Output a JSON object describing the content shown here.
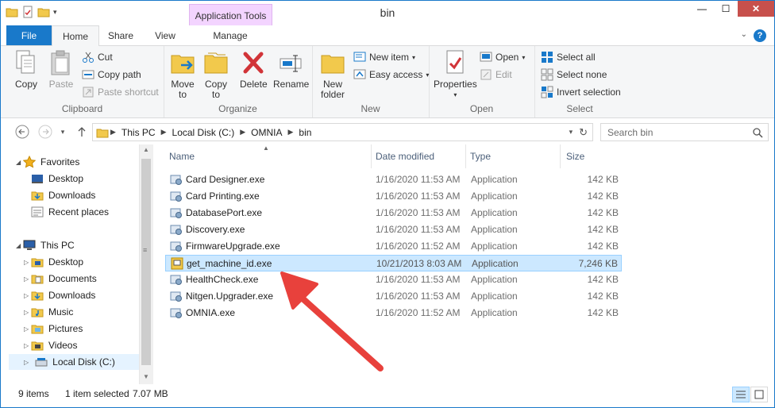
{
  "window": {
    "title": "bin",
    "contextual_tab": "Application Tools",
    "controls": {
      "minimize": "—",
      "maximize": "☐",
      "close": "✕"
    }
  },
  "tabs": {
    "file": "File",
    "home": "Home",
    "share": "Share",
    "view": "View",
    "manage": "Manage"
  },
  "ribbon": {
    "clipboard": {
      "label": "Clipboard",
      "copy": "Copy",
      "paste": "Paste",
      "cut": "Cut",
      "copy_path": "Copy path",
      "paste_shortcut": "Paste shortcut"
    },
    "organize": {
      "label": "Organize",
      "move_to_1": "Move",
      "move_to_2": "to",
      "copy_to_1": "Copy",
      "copy_to_2": "to",
      "delete": "Delete",
      "rename": "Rename"
    },
    "new": {
      "label": "New",
      "new_folder_1": "New",
      "new_folder_2": "folder",
      "new_item": "New item",
      "easy_access": "Easy access"
    },
    "open": {
      "label": "Open",
      "properties": "Properties",
      "open": "Open",
      "edit": "Edit"
    },
    "select": {
      "label": "Select",
      "select_all": "Select all",
      "select_none": "Select none",
      "invert_selection": "Invert selection"
    }
  },
  "address": {
    "crumbs": [
      "This PC",
      "Local Disk (C:)",
      "OMNIA",
      "bin"
    ],
    "search_placeholder": "Search bin"
  },
  "nav": {
    "favorites": "Favorites",
    "desktop": "Desktop",
    "downloads": "Downloads",
    "recent": "Recent places",
    "this_pc": "This PC",
    "pc_desktop": "Desktop",
    "documents": "Documents",
    "pc_downloads": "Downloads",
    "music": "Music",
    "pictures": "Pictures",
    "videos": "Videos",
    "local_disk": "Local Disk (C:)"
  },
  "columns": {
    "name": "Name",
    "date": "Date modified",
    "type": "Type",
    "size": "Size"
  },
  "files": [
    {
      "name": "Card Designer.exe",
      "date": "1/16/2020 11:53 AM",
      "type": "Application",
      "size": "142 KB"
    },
    {
      "name": "Card Printing.exe",
      "date": "1/16/2020 11:53 AM",
      "type": "Application",
      "size": "142 KB"
    },
    {
      "name": "DatabasePort.exe",
      "date": "1/16/2020 11:53 AM",
      "type": "Application",
      "size": "142 KB"
    },
    {
      "name": "Discovery.exe",
      "date": "1/16/2020 11:53 AM",
      "type": "Application",
      "size": "142 KB"
    },
    {
      "name": "FirmwareUpgrade.exe",
      "date": "1/16/2020 11:52 AM",
      "type": "Application",
      "size": "142 KB"
    },
    {
      "name": "get_machine_id.exe",
      "date": "10/21/2013 8:03 AM",
      "type": "Application",
      "size": "7,246 KB"
    },
    {
      "name": "HealthCheck.exe",
      "date": "1/16/2020 11:53 AM",
      "type": "Application",
      "size": "142 KB"
    },
    {
      "name": "Nitgen.Upgrader.exe",
      "date": "1/16/2020 11:53 AM",
      "type": "Application",
      "size": "142 KB"
    },
    {
      "name": "OMNIA.exe",
      "date": "1/16/2020 11:52 AM",
      "type": "Application",
      "size": "142 KB"
    }
  ],
  "status": {
    "count": "9 items",
    "selected": "1 item selected",
    "size": "7.07 MB"
  },
  "colors": {
    "accent": "#1979ca",
    "selection": "#cce8ff",
    "arrow": "#e8413c"
  }
}
